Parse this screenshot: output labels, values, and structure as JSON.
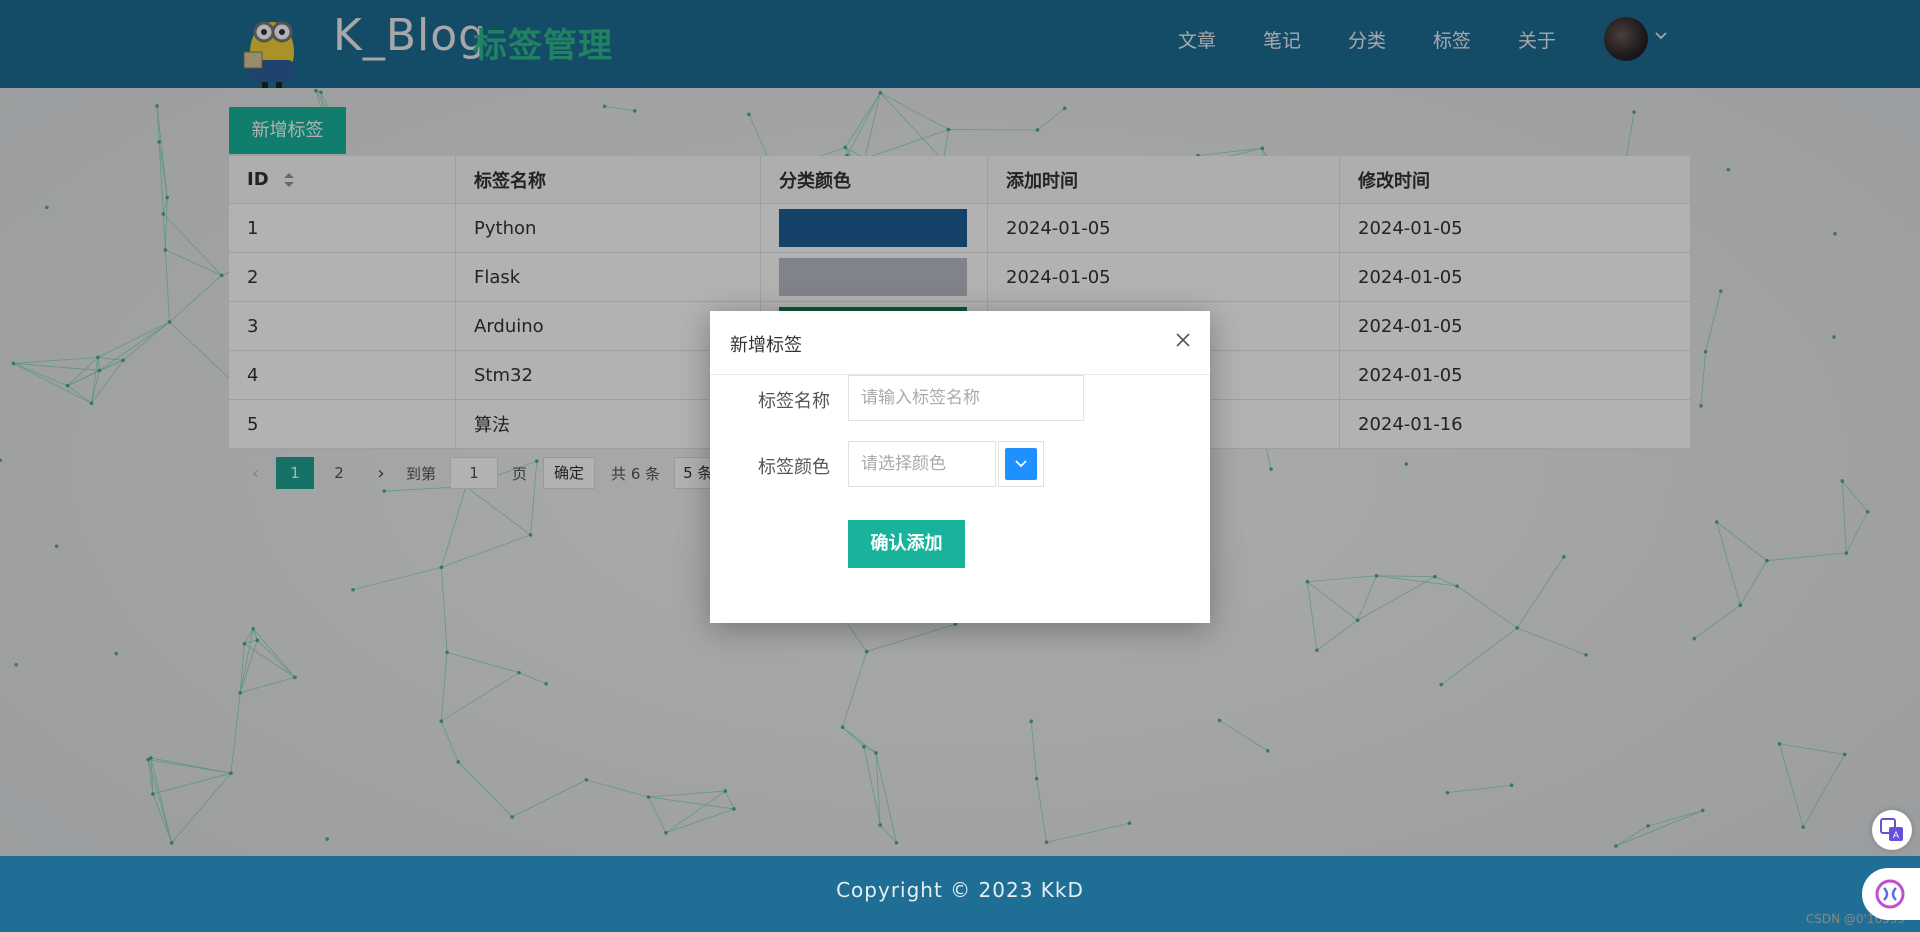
{
  "header": {
    "brand": "K_Blog",
    "subtitle": "标签管理",
    "nav": [
      "文章",
      "笔记",
      "分类",
      "标签",
      "关于"
    ]
  },
  "toolbar": {
    "add_tag_label": "新增标签"
  },
  "table": {
    "columns": [
      "ID",
      "标签名称",
      "分类颜色",
      "添加时间",
      "修改时间"
    ],
    "rows": [
      {
        "id": "1",
        "name": "Python",
        "color": "#1e5e96",
        "added": "2024-01-05",
        "modified": "2024-01-05"
      },
      {
        "id": "2",
        "name": "Flask",
        "color": "#b8bec6",
        "added": "2024-01-05",
        "modified": "2024-01-05"
      },
      {
        "id": "3",
        "name": "Arduino",
        "color": "#0f7d4a",
        "added": "2024-01-05",
        "modified": "2024-01-05"
      },
      {
        "id": "4",
        "name": "Stm32",
        "color": "#ffffff",
        "added": "2024-01-05",
        "modified": "2024-01-05"
      },
      {
        "id": "5",
        "name": "算法",
        "color": "#ffffff",
        "added": "2024-01-16",
        "modified": "2024-01-16"
      }
    ]
  },
  "pagination": {
    "pages": [
      "1",
      "2"
    ],
    "current_page": "1",
    "goto_prefix": "到第",
    "goto_value": "1",
    "goto_suffix": "页",
    "confirm_label": "确定",
    "total_label": "共 6 条",
    "page_size_label": "5 条"
  },
  "dialog": {
    "title": "新增标签",
    "name_label": "标签名称",
    "name_placeholder": "请输入标签名称",
    "color_label": "标签颜色",
    "color_placeholder": "请选择颜色",
    "submit_label": "确认添加"
  },
  "footer": {
    "copyright": "Copyright  ©  2023  KkD",
    "watermark": "CSDN @0'16599"
  },
  "colors": {
    "header_bg": "#1e6e96",
    "accent": "#19b39b",
    "picker": "#1e90ff"
  }
}
